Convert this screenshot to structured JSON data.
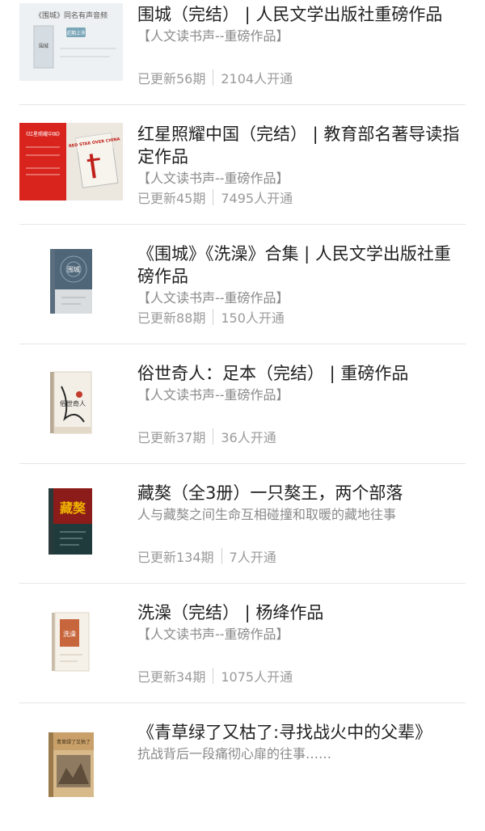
{
  "items": [
    {
      "title": "围城（完结） | 人民文学出版社重磅作品",
      "subtitle": "【人文读书声--重磅作品】",
      "updates": "已更新56期",
      "subscribers": "2104人开通",
      "cover": {
        "kind": "banner-light",
        "headline": "《围城》同名有声音频",
        "badge": "近期上市",
        "tagline": "城外的人想冲进去，城里的人想逃出来",
        "book_title": "围城"
      }
    },
    {
      "title": "红星照耀中国（完结） | 教育部名著导读指定作品",
      "subtitle": "【人文读书声--重磅作品】",
      "updates": "已更新45期",
      "subscribers": "7495人开通",
      "cover": {
        "kind": "banner-red",
        "headline": "《红星照耀中国》",
        "book_title": "RED STAR OVER CHINA"
      }
    },
    {
      "title": "《围城》《洗澡》合集 | 人民文学出版社重磅作品",
      "subtitle": "【人文读书声--重磅作品】",
      "updates": "已更新88期",
      "subscribers": "150人开通",
      "cover": {
        "kind": "book-blue",
        "book_title": "围城"
      }
    },
    {
      "title": "俗世奇人：足本（完结） | 重磅作品",
      "subtitle": "【人文读书声--重磅作品】",
      "updates": "已更新37期",
      "subscribers": "36人开通",
      "cover": {
        "kind": "book-white",
        "book_title": "俗世奇人"
      }
    },
    {
      "title": "藏獒（全3册）一只獒王，两个部落",
      "subtitle": "人与藏獒之间生命互相碰撞和取暖的藏地往事",
      "updates": "已更新134期",
      "subscribers": "7人开通",
      "cover": {
        "kind": "book-dark",
        "book_title": "藏獒"
      }
    },
    {
      "title": "洗澡（完结） | 杨绛作品",
      "subtitle": "【人文读书声--重磅作品】",
      "updates": "已更新34期",
      "subscribers": "1075人开通",
      "cover": {
        "kind": "book-brown",
        "book_title": "洗澡"
      }
    },
    {
      "title": "《青草绿了又枯了:寻找战火中的父辈》",
      "subtitle": "抗战背后一段痛彻心扉的往事……",
      "updates": "",
      "subscribers": "",
      "cover": {
        "kind": "book-sepia",
        "book_title": "青草绿了又枯了"
      }
    }
  ],
  "colors": {
    "title": "#1f1f1f",
    "subtitle": "#8a8a8a",
    "meta": "#9a9a9a",
    "divider": "#e6e6e6"
  }
}
